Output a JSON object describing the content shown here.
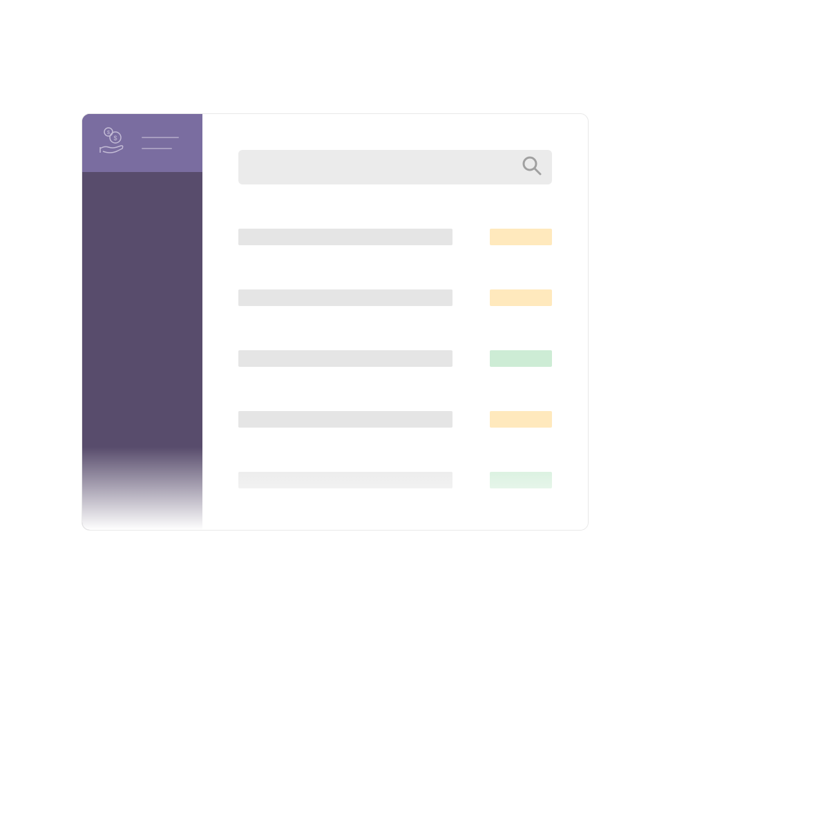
{
  "colors": {
    "sidebar_bg": "#584c6c",
    "sidebar_header_bg": "#7a6da0",
    "search_bg": "#ebebeb",
    "row_label_bg": "#e5e5e5",
    "status_orange": "#ffe9bd",
    "status_green": "#cdecd5"
  },
  "icons": {
    "logo": "money-hand-icon",
    "search": "search-icon"
  },
  "search": {
    "placeholder": ""
  },
  "rows": [
    {
      "label": "",
      "status_color": "orange"
    },
    {
      "label": "",
      "status_color": "orange"
    },
    {
      "label": "",
      "status_color": "green"
    },
    {
      "label": "",
      "status_color": "orange"
    },
    {
      "label": "",
      "status_color": "green"
    }
  ]
}
